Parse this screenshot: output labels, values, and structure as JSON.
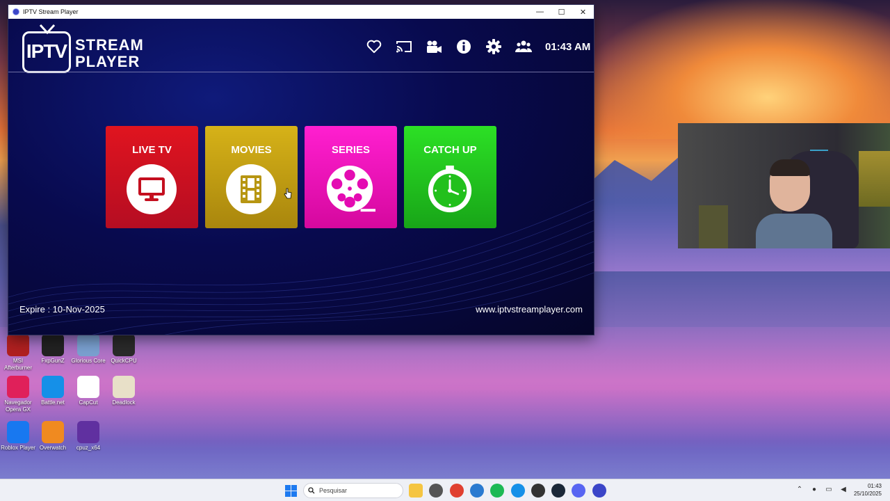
{
  "window": {
    "title": "IPTV Stream Player",
    "controls": {
      "minimize": "—",
      "maximize": "☐",
      "close": "✕"
    }
  },
  "app": {
    "logo": {
      "box": "IPTV",
      "line1": "STREAM",
      "line2": "PLAYER"
    },
    "header_icons": [
      "heart-icon",
      "cast-icon",
      "video-camera-icon",
      "info-icon",
      "settings-icon",
      "users-icon"
    ],
    "clock": "01:43 AM",
    "tiles": [
      {
        "label": "LIVE TV",
        "icon": "tv-icon",
        "color": "#d41020"
      },
      {
        "label": "MOVIES",
        "icon": "film-icon",
        "color": "#c9a412"
      },
      {
        "label": "SERIES",
        "icon": "film-reel-icon",
        "color": "#f414c0"
      },
      {
        "label": "CATCH UP",
        "icon": "clock-icon",
        "color": "#26cc20"
      }
    ],
    "expire": "Expire : 10-Nov-2025",
    "website": "www.iptvstreamplayer.com"
  },
  "desktop_icons": [
    {
      "label": "MSI Afterburner",
      "color": "#b02020"
    },
    {
      "label": "FxpGunZ",
      "color": "#222"
    },
    {
      "label": "Glorious Core",
      "color": "#7aa0d0"
    },
    {
      "label": "QuickCPU",
      "color": "#2a2a2a"
    },
    {
      "label": "Navegador Opera GX",
      "color": "#e0205a"
    },
    {
      "label": "Battle.net",
      "color": "#1590e8"
    },
    {
      "label": "CapCut",
      "color": "#ffffff"
    },
    {
      "label": "Deadlock",
      "color": "#e8e0c8"
    },
    {
      "label": "Roblox Player",
      "color": "#1878f0"
    },
    {
      "label": "Overwatch",
      "color": "#f08a20"
    },
    {
      "label": "cpuz_x64",
      "color": "#6030a0"
    }
  ],
  "taskbar": {
    "search_placeholder": "Pesquisar",
    "apps": [
      "file-explorer-icon",
      "overwatch-icon",
      "chrome-icon",
      "chrome-dev-icon",
      "spotify-icon",
      "battlenet-icon",
      "app-icon",
      "steam-icon",
      "discord-icon",
      "iptv-icon"
    ],
    "time": "01:43",
    "date": "25/10/2025"
  }
}
